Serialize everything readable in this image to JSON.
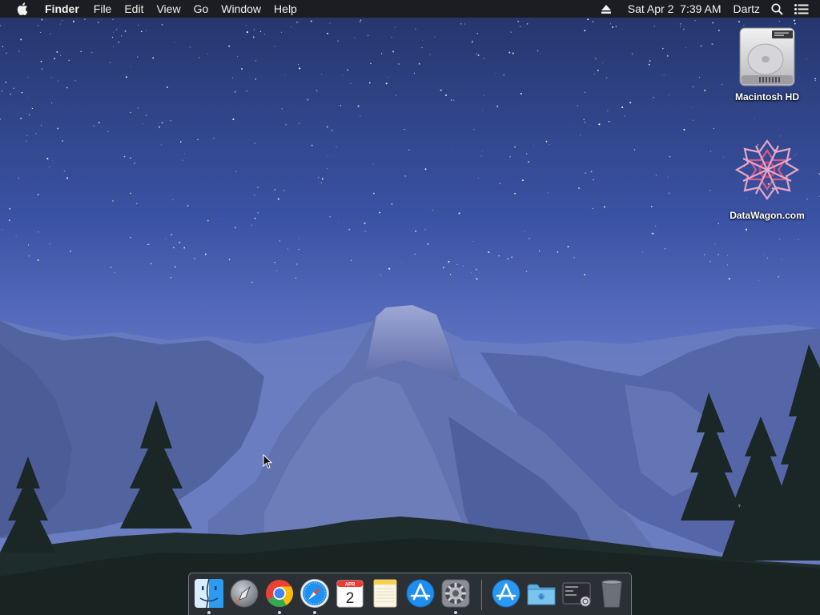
{
  "menubar": {
    "apple_icon": "apple-icon",
    "app_name": "Finder",
    "items": [
      "File",
      "Edit",
      "View",
      "Go",
      "Window",
      "Help"
    ],
    "status": {
      "eject_icon": "eject-icon",
      "datetime": "Sat Apr 2  7:39 AM",
      "user": "Dartz",
      "spotlight_icon": "magnifier-icon",
      "notification_icon": "list-icon"
    }
  },
  "desktop": {
    "icons": [
      {
        "label": "Macintosh HD",
        "icon": "hard-drive-icon"
      },
      {
        "label": "DataWagon.com",
        "icon": "datawagon-logo-icon"
      }
    ]
  },
  "dock": {
    "apps": [
      {
        "name": "Finder",
        "icon": "finder-icon",
        "running": true
      },
      {
        "name": "Launchpad",
        "icon": "launchpad-rocket-icon",
        "running": false
      },
      {
        "name": "Google Chrome",
        "icon": "chrome-icon",
        "running": true
      },
      {
        "name": "Safari",
        "icon": "safari-compass-icon",
        "running": true
      },
      {
        "name": "Calendar",
        "icon": "calendar-icon",
        "running": false,
        "month": "APR",
        "day": "2"
      },
      {
        "name": "Notes",
        "icon": "notes-icon",
        "running": false
      },
      {
        "name": "App Store",
        "icon": "app-store-icon",
        "running": false
      },
      {
        "name": "System Preferences",
        "icon": "gear-icon",
        "running": true
      }
    ],
    "stacks": [
      {
        "name": "Applications",
        "icon": "app-store-icon"
      },
      {
        "name": "Downloads",
        "icon": "folder-icon"
      },
      {
        "name": "Screenshots",
        "icon": "screenshot-stack-icon"
      },
      {
        "name": "Trash",
        "icon": "trash-icon"
      }
    ]
  },
  "colors": {
    "menubar_bg": "#1c1d22",
    "sky_top": "#263670",
    "sky_bottom": "#6677c4",
    "mountain": "#6f7fb8",
    "forest": "#1d2a2a"
  }
}
